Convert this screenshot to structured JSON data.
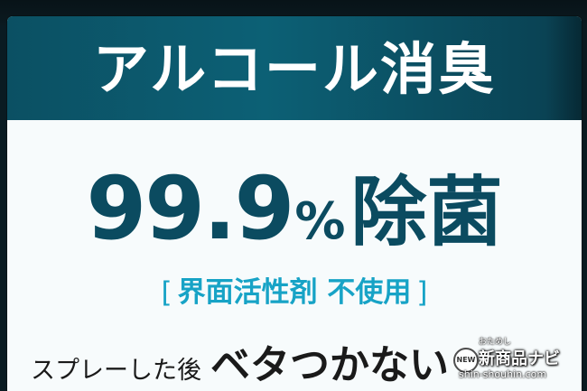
{
  "product_label": {
    "headline": "アルコール消臭",
    "main_claim": {
      "number": "99.9",
      "percent": "%",
      "word": "除菌"
    },
    "sub_claim": {
      "open_bracket": "[",
      "text": "界面活性剤 不使用",
      "close_bracket": "]"
    },
    "tagline": {
      "lead": "スプレーした後",
      "emphasis": "ベタつかない"
    }
  },
  "watermark": {
    "badge": "NEW",
    "small_text": "おためし",
    "brand": "新商品ナビ",
    "url": "shin-shouhin.com"
  },
  "colors": {
    "banner": "#0c6075",
    "claim_text": "#0b4b60",
    "sub_claim_text": "#17a3c6",
    "label_background": "#f7fbfc"
  }
}
